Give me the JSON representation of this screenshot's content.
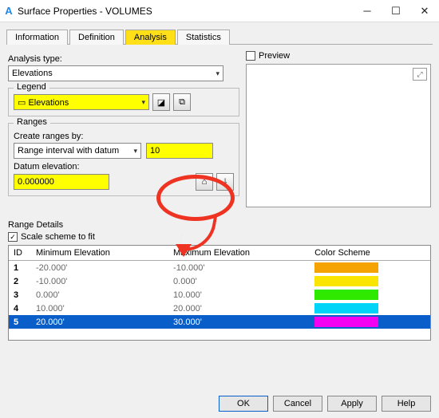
{
  "window": {
    "logo": "A",
    "title": "Surface Properties - VOLUMES"
  },
  "tabs": {
    "information": "Information",
    "definition": "Definition",
    "analysis": "Analysis",
    "statistics": "Statistics"
  },
  "analysis": {
    "type_label": "Analysis type:",
    "type_value": "Elevations",
    "preview_label": "Preview",
    "legend": {
      "title": "Legend",
      "value": "Elevations"
    },
    "ranges": {
      "title": "Ranges",
      "create_by_label": "Create ranges by:",
      "create_by_value": "Range interval with datum",
      "interval_value": "10",
      "datum_label": "Datum elevation:",
      "datum_value": "0.000000"
    }
  },
  "range_details": {
    "title": "Range Details",
    "scale_label": "Scale scheme to fit",
    "headers": {
      "id": "ID",
      "min": "Minimum Elevation",
      "max": "Maximum Elevation",
      "color": "Color Scheme"
    },
    "rows": [
      {
        "id": "1",
        "min": "-20.000'",
        "max": "-10.000'",
        "color": "#f5a301"
      },
      {
        "id": "2",
        "min": "-10.000'",
        "max": "0.000'",
        "color": "#f9e501"
      },
      {
        "id": "3",
        "min": "0.000'",
        "max": "10.000'",
        "color": "#2fe900"
      },
      {
        "id": "4",
        "min": "10.000'",
        "max": "20.000'",
        "color": "#02d4f7"
      },
      {
        "id": "5",
        "min": "20.000'",
        "max": "30.000'",
        "color": "#f300f3"
      }
    ]
  },
  "footer": {
    "ok": "OK",
    "cancel": "Cancel",
    "apply": "Apply",
    "help": "Help"
  },
  "icons": {
    "run1": "⌂",
    "run2": "⤓",
    "legend_btn1": "◪",
    "legend_btn2": "⧉",
    "zoom": "⤢",
    "legend_layer": "▭"
  }
}
